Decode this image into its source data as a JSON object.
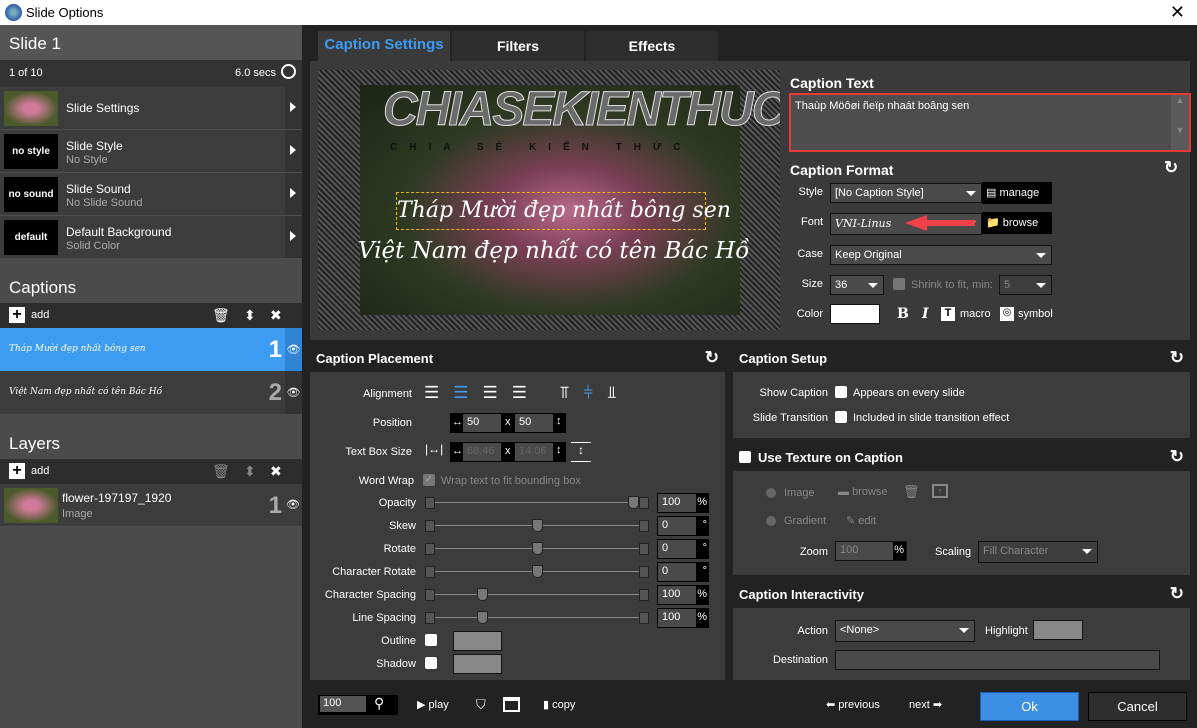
{
  "window": {
    "title": "Slide Options",
    "close": "✕"
  },
  "slide": {
    "title": "Slide 1",
    "position": "1 of 10",
    "duration": "6.0 secs",
    "items": [
      {
        "label": "Slide Settings",
        "sub": "",
        "thumb": ""
      },
      {
        "label": "Slide Style",
        "sub": "No Style",
        "thumb": "no style"
      },
      {
        "label": "Slide Sound",
        "sub": "No Slide Sound",
        "thumb": "no sound"
      },
      {
        "label": "Default Background",
        "sub": "Solid Color",
        "thumb": "default"
      }
    ]
  },
  "captions": {
    "title": "Captions",
    "add": "add",
    "items": [
      {
        "text": "Tháp Mười đẹp nhất bông sen",
        "num": "1",
        "selected": true
      },
      {
        "text": "Việt Nam đẹp nhất có tên Bác Hồ",
        "num": "2",
        "selected": false
      }
    ]
  },
  "layers": {
    "title": "Layers",
    "add": "add",
    "items": [
      {
        "name": "flower-197197_1920",
        "type": "Image",
        "num": "1"
      }
    ]
  },
  "tabs": [
    {
      "label": "Caption Settings",
      "active": true
    },
    {
      "label": "Filters"
    },
    {
      "label": "Effects"
    }
  ],
  "preview": {
    "watermark": "CHIASEKIENTHUC",
    "watermark_sub": "CHIA SẺ KIẾN THỨC",
    "caption1": "Tháp Mười đẹp nhất bông sen",
    "caption2": "Việt Nam đẹp nhất có tên Bác Hồ"
  },
  "caption_text": {
    "title": "Caption Text",
    "value": "Thaùp Möôøi ñeïp nhaát boâng sen"
  },
  "caption_format": {
    "title": "Caption Format",
    "style_label": "Style",
    "style_value": "[No Caption Style]",
    "manage": "manage",
    "font_label": "Font",
    "font_value": "VNI-Linus",
    "browse": "browse",
    "case_label": "Case",
    "case_value": "Keep Original",
    "size_label": "Size",
    "size_value": "36",
    "shrink_label": "Shrink to fit, min:",
    "shrink_value": "5",
    "color_label": "Color",
    "color_value": "#ffffff",
    "bold": "B",
    "italic": "I",
    "macro": "macro",
    "symbol": "symbol"
  },
  "placement": {
    "title": "Caption Placement",
    "alignment_label": "Alignment",
    "position_label": "Position",
    "pos_x": "50",
    "pos_y": "50",
    "x_sep": "x",
    "textbox_label": "Text Box Size",
    "tb_w": "68.46",
    "tb_h": "14.06",
    "wordwrap_label": "Word Wrap",
    "wordwrap_text": "Wrap text to fit bounding box",
    "sliders": [
      {
        "label": "Opacity",
        "value": "100",
        "unit": "%",
        "fraction": 1.0
      },
      {
        "label": "Skew",
        "value": "0",
        "unit": "°",
        "fraction": 0.5
      },
      {
        "label": "Rotate",
        "value": "0",
        "unit": "°",
        "fraction": 0.5
      },
      {
        "label": "Character Rotate",
        "value": "0",
        "unit": "°",
        "fraction": 0.5
      },
      {
        "label": "Character Spacing",
        "value": "100",
        "unit": "%",
        "fraction": 0.22
      },
      {
        "label": "Line Spacing",
        "value": "100",
        "unit": "%",
        "fraction": 0.22
      }
    ],
    "outline_label": "Outline",
    "shadow_label": "Shadow"
  },
  "setup": {
    "title": "Caption Setup",
    "show_label": "Show Caption",
    "show_text": "Appears on every slide",
    "trans_label": "Slide Transition",
    "trans_text": "Included in slide transition effect"
  },
  "texture": {
    "title": "Use Texture on Caption",
    "image": "Image",
    "browse": "browse",
    "gradient": "Gradient",
    "edit": "edit",
    "zoom_label": "Zoom",
    "zoom_value": "100",
    "zoom_unit": "%",
    "scaling_label": "Scaling",
    "scaling_value": "Fill Character"
  },
  "interactivity": {
    "title": "Caption Interactivity",
    "action_label": "Action",
    "action_value": "<None>",
    "highlight_label": "Highlight",
    "destination_label": "Destination",
    "destination_value": ""
  },
  "bottombar": {
    "zoom": "100",
    "play": "play",
    "copy": "copy",
    "previous": "previous",
    "next": "next",
    "ok": "Ok",
    "cancel": "Cancel"
  },
  "colors": {
    "accent": "#3d9bf2",
    "selection_border": "#e53935",
    "handle": "#f5b400"
  }
}
